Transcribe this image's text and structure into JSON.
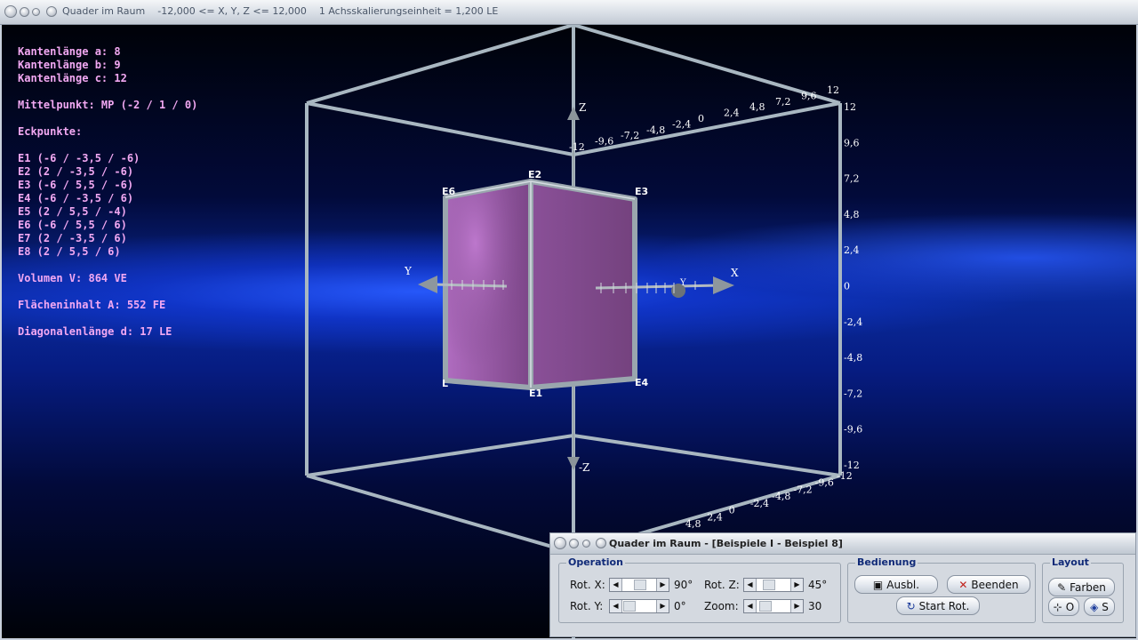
{
  "window": {
    "title": "Quader im Raum",
    "range": "-12,000 <= X, Y, Z <= 12,000",
    "scale": "1 Achsskalierungseinheit = 1,200 LE"
  },
  "info": {
    "edge_a": "Kantenlänge a: 8",
    "edge_b": "Kantenlänge b: 9",
    "edge_c": "Kantenlänge c: 12",
    "midpoint": "Mittelpunkt: MP (-2 / 1 / 0)",
    "vertices_heading": "Eckpunkte:",
    "vertices": [
      "E1 (-6 / -3,5 / -6)",
      "E2 (2 / -3,5 / -6)",
      "E3 (-6 / 5,5 / -6)",
      "E4 (-6 / -3,5 / 6)",
      "E5 (2 / 5,5 / -4)",
      "E6 (-6 / 5,5 / 6)",
      "E7 (2 / -3,5 / 6)",
      "E8 (2 / 5,5 / 6)"
    ],
    "volume": "Volumen V: 864 VE",
    "area": "Flächeninhalt A: 552 FE",
    "diagonal": "Diagonalenlänge d: 17 LE"
  },
  "scene_labels": {
    "axis_x": "X",
    "axis_y": "Y",
    "axis_y_far": "Y",
    "axis_z": "Z",
    "axis_neg_z": "-Z",
    "e1": "E1",
    "e2": "E2",
    "e3": "E3",
    "e4": "E4",
    "e6": "E6",
    "l": "L"
  },
  "ticks": {
    "right": [
      "12",
      "9,6",
      "7,2",
      "4,8",
      "2,4",
      "0",
      "-2,4",
      "-4,8",
      "-7,2",
      "-9,6",
      "-12"
    ],
    "top": [
      "-12",
      "-9,6",
      "-7,2",
      "-4,8",
      "-2,4",
      "0",
      "2,4",
      "4,8",
      "7,2",
      "9,6",
      "12"
    ],
    "bottom": [
      "4,8",
      "2,4",
      "0",
      "-2,4",
      "-4,8",
      "-7,2",
      "-9,6",
      "-12"
    ]
  },
  "panel": {
    "title": "Quader im Raum - [Beispiele I - Beispiel 8]",
    "operation": {
      "label": "Operation",
      "rot_x_label": "Rot. X:",
      "rot_x_value": "90°",
      "rot_y_label": "Rot. Y:",
      "rot_y_value": "0°",
      "rot_z_label": "Rot. Z:",
      "rot_z_value": "45°",
      "zoom_label": "Zoom:",
      "zoom_value": "30"
    },
    "bedienung": {
      "label": "Bedienung",
      "ausbl": "Ausbl.",
      "beenden": "Beenden",
      "start_rot": "Start Rot."
    },
    "layout": {
      "label": "Layout",
      "farben": "Farben",
      "o": "O",
      "s": "S"
    }
  },
  "colors": {
    "info_text": "#f2a8f2",
    "box_face": "#8a4e96",
    "frame": "#a7b6c0",
    "panel_accent": "#102a78"
  }
}
